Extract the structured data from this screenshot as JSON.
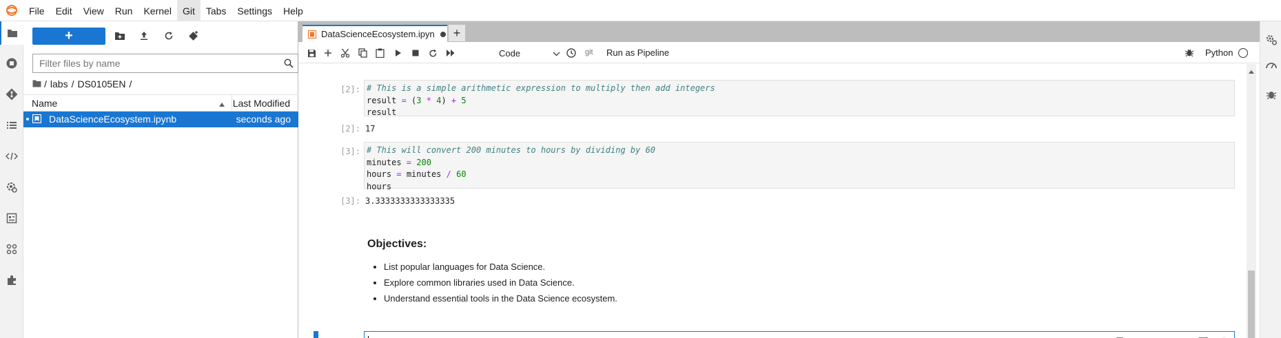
{
  "menubar": {
    "items": [
      "File",
      "Edit",
      "View",
      "Run",
      "Kernel",
      "Git",
      "Tabs",
      "Settings",
      "Help"
    ]
  },
  "activity_icons": [
    "folder-icon",
    "running-icon",
    "git-icon",
    "toc-icon",
    "code-snippets-icon",
    "extension-settings-icon",
    "property-inspector-icon",
    "elyra-icon",
    "extension-icon"
  ],
  "filebrowser": {
    "search_placeholder": "Filter files by name",
    "breadcrumb": [
      "/",
      "labs",
      "/",
      "DS0105EN",
      "/"
    ],
    "columns": {
      "name": "Name",
      "modified": "Last Modified"
    },
    "files": [
      {
        "name": "DataScienceEcosystem.ipynb",
        "modified": "seconds ago",
        "selected": true
      }
    ]
  },
  "tab": {
    "title": "DataScienceEcosystem.ipyn",
    "dirty": true
  },
  "nb_toolbar": {
    "cell_type": "Code",
    "git_label": "git",
    "pipeline": "Run as Pipeline",
    "kernel": "Python"
  },
  "cells": {
    "c2_prompt": "[2]:",
    "c2_line1": "# This is a simple arithmetic expression to multiply then add integers",
    "c2_out_prompt": "[2]:",
    "c2_output": "17",
    "c3_prompt": "[3]:",
    "c3_line1": "# This will convert 200 minutes to hours by dividing by 60",
    "c3_out_prompt": "[3]:",
    "c3_output": "3.3333333333333335",
    "md_heading": "Objectives:",
    "md_items": [
      "List popular languages for Data Science.",
      "Explore common libraries used in Data Science.",
      "Understand essential tools in the Data Science ecosystem."
    ],
    "empty_prompt": "[ ]:"
  },
  "colors": {
    "accent": "#1976d2",
    "tab_bg": "#bdbdbd"
  }
}
